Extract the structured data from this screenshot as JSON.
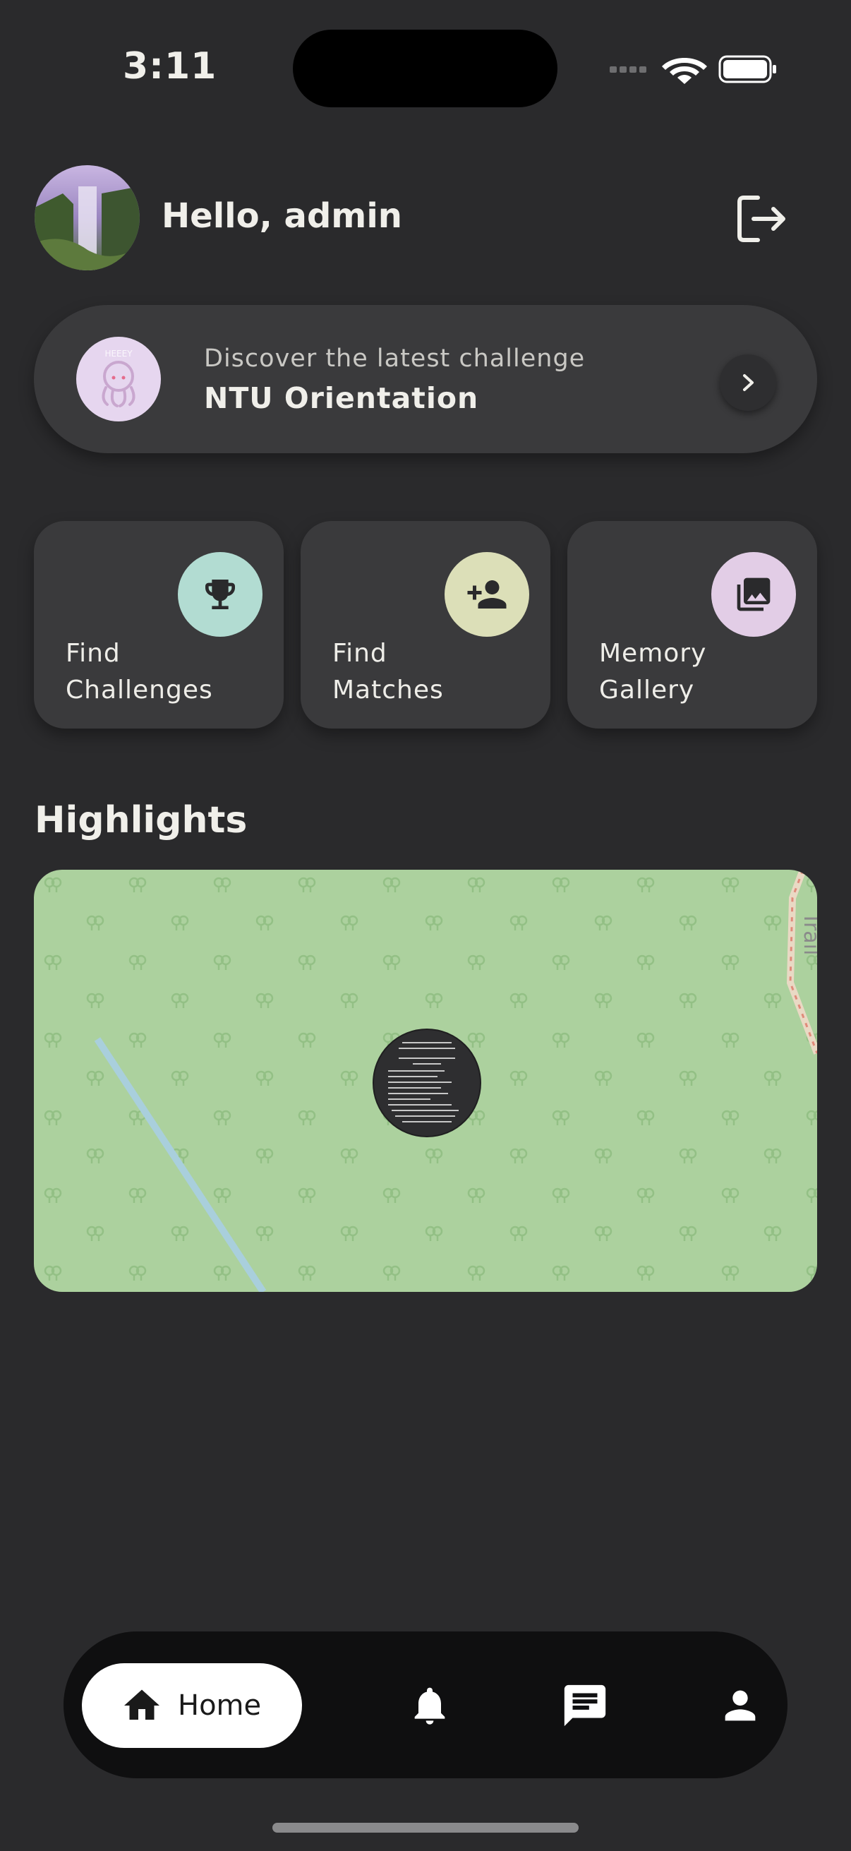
{
  "status_bar": {
    "time": "3:11"
  },
  "header": {
    "greeting": "Hello, admin"
  },
  "challenge_banner": {
    "subtitle": "Discover the latest challenge",
    "title": "NTU Orientation"
  },
  "tiles": [
    {
      "label_line1": "Find",
      "label_line2": "Challenges",
      "icon": "trophy-icon",
      "color": "#b2dcd2"
    },
    {
      "label_line1": "Find",
      "label_line2": "Matches",
      "icon": "person-add-icon",
      "color": "#dcdfb8"
    },
    {
      "label_line1": "Memory",
      "label_line2": "Gallery",
      "icon": "photo-library-icon",
      "color": "#e2cde6"
    }
  ],
  "highlights": {
    "title": "Highlights",
    "map_label": "Trail"
  },
  "bottom_nav": {
    "home_label": "Home",
    "items": [
      "home-icon",
      "bell-icon",
      "chat-icon",
      "person-icon"
    ]
  },
  "colors": {
    "background": "#2a2a2c",
    "card": "#3a3a3c",
    "map_green": "#acd19e",
    "nav_bg": "#0f0f10"
  }
}
